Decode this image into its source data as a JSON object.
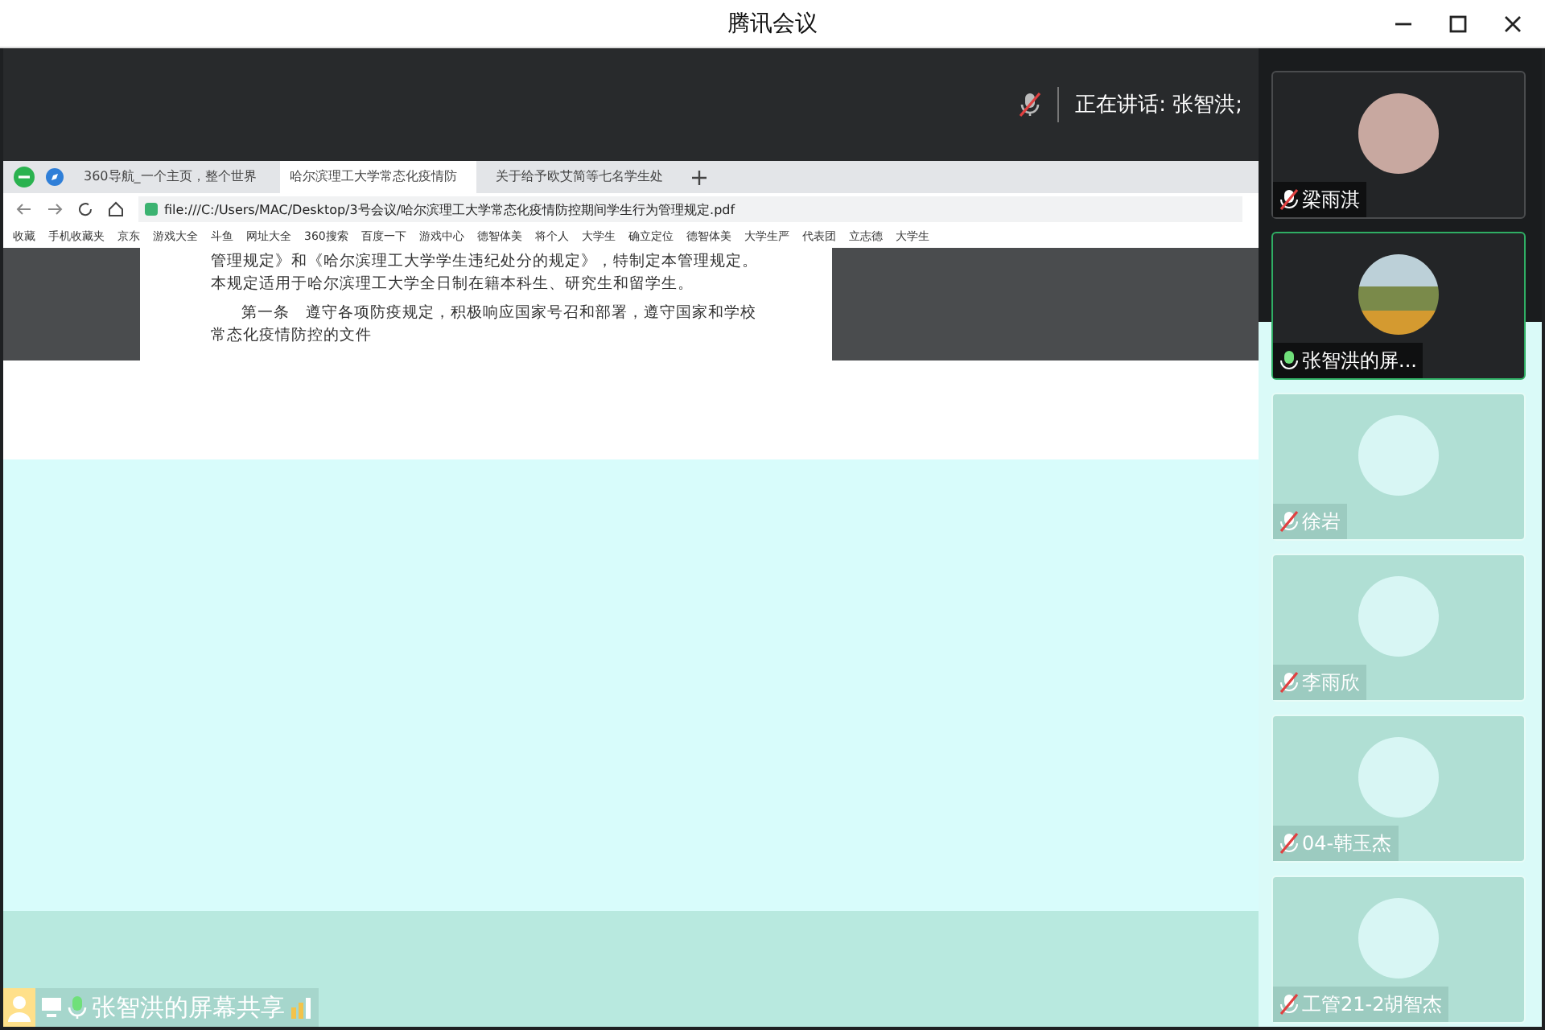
{
  "window": {
    "title": "腾讯会议"
  },
  "speaking": {
    "label": "正在讲话: 张智洪;"
  },
  "browser": {
    "tabs": [
      {
        "label": "360导航_一个主页，整个世界",
        "selected": false
      },
      {
        "label": "哈尔滨理工大学常态化疫情防",
        "selected": true
      },
      {
        "label": "关于给予欧艾简等七名学生处",
        "selected": false
      }
    ],
    "address": "file:///C:/Users/MAC/Desktop/3号会议/哈尔滨理工大学常态化疫情防控期间学生行为管理规定.pdf",
    "bookmarks": [
      "收藏",
      "手机收藏夹",
      "京东",
      "游戏大全",
      "斗鱼",
      "网址大全",
      "360搜索",
      "百度一下",
      "游戏中心",
      "德智体美",
      "将个人",
      "大学生",
      "确立定位",
      "德智体美",
      "大学生严",
      "代表团",
      "立志德",
      "大学生"
    ]
  },
  "document": {
    "paragraphs": [
      "管理规定》和《哈尔滨理工大学学生违纪处分的规定》，特制定本管理规定。本规定适用于哈尔滨理工大学全日制在籍本科生、研究生和留学生。",
      "第一条　遵守各项防疫规定，积极响应国家号召和部署，遵守国家和学校常态化疫情防控的文件"
    ]
  },
  "share_label": {
    "text": "张智洪的屏幕共享"
  },
  "participants": [
    {
      "name": "梁雨淇",
      "kind": "camera",
      "muted": true,
      "selected": false
    },
    {
      "name": "张智洪的屏...",
      "kind": "sharing",
      "muted": false,
      "selected": true
    },
    {
      "name": "徐岩",
      "kind": "camera",
      "muted": true,
      "selected": false
    },
    {
      "name": "李雨欣",
      "kind": "camera",
      "muted": true,
      "selected": false
    },
    {
      "name": "04-韩玉杰",
      "kind": "camera",
      "muted": true,
      "selected": false
    },
    {
      "name": "工管21-2胡智杰",
      "kind": "camera",
      "muted": true,
      "selected": false
    }
  ]
}
